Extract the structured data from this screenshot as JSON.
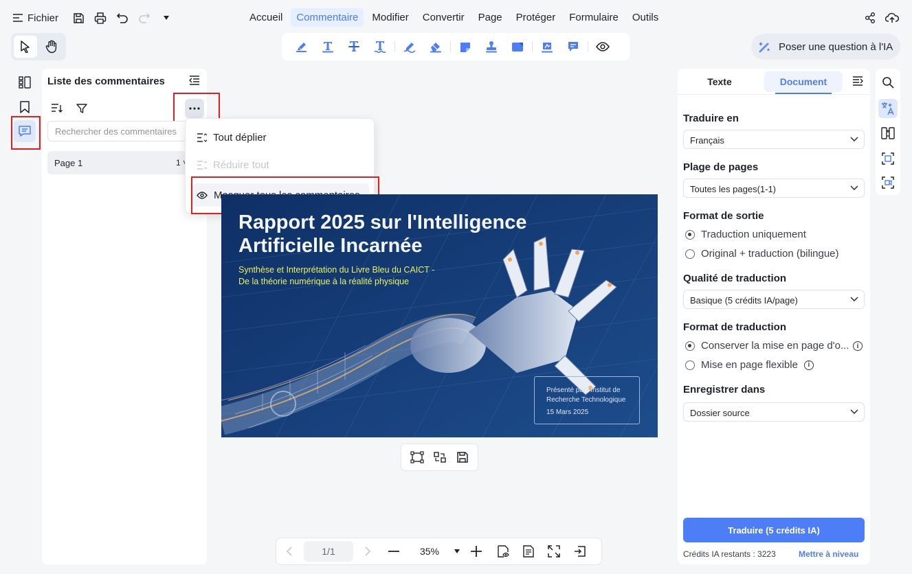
{
  "menu": {
    "file_label": "Fichier",
    "items": [
      "Accueil",
      "Commentaire",
      "Modifier",
      "Convertir",
      "Page",
      "Protéger",
      "Formulaire",
      "Outils"
    ],
    "active": "Commentaire"
  },
  "ai_button": {
    "label": "Poser une question à l'IA"
  },
  "comments_panel": {
    "title": "Liste des commentaires",
    "search_placeholder": "Rechercher des commentaires",
    "page_label": "Page 1",
    "page_count": "1"
  },
  "dropdown": {
    "expand_all": "Tout déplier",
    "collapse_all": "Réduire tout",
    "hide_all": "Masquer tous les commentaires"
  },
  "document": {
    "title_line1": "Rapport 2025 sur l'Intelligence",
    "title_line2": "Artificielle Incarnée",
    "subtitle_line1": "Synthèse et Interprétation du Livre Bleu du CAICT -",
    "subtitle_line2": "De la théorie numérique à la réalité physique",
    "presented_line1": "Présenté par l'Institut de",
    "presented_line2": "Recherche Technologique",
    "date": "15 Mars 2025"
  },
  "navigation": {
    "page": "1/1",
    "zoom": "35%"
  },
  "right_panel": {
    "tab_text": "Texte",
    "tab_document": "Document",
    "translate_to_label": "Traduire en",
    "translate_to_value": "Français",
    "page_range_label": "Plage de pages",
    "page_range_value": "Toutes les pages(1-1)",
    "output_format_label": "Format de sortie",
    "output_option1": "Traduction uniquement",
    "output_option2": "Original + traduction (bilingue)",
    "quality_label": "Qualité de traduction",
    "quality_value": "Basique (5 crédits IA/page)",
    "translation_format_label": "Format de traduction",
    "format_option1": "Conserver la mise en page d'o...",
    "format_option2": "Mise en page flexible",
    "save_in_label": "Enregistrer dans",
    "save_in_value": "Dossier source",
    "translate_button": "Traduire (5 crédits IA)",
    "credits_remaining": "Crédits IA restants : 3223",
    "upgrade_link": "Mettre à niveau"
  },
  "colors": {
    "accent": "#4d7ef7",
    "highlight_red": "#e02020",
    "doc_bg": "#13366e"
  }
}
